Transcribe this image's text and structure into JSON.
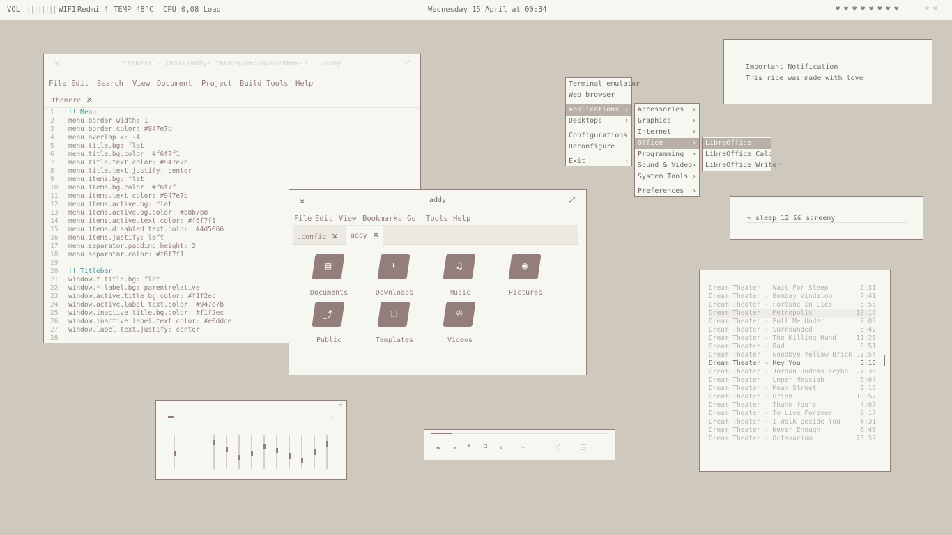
{
  "topbar": {
    "vol_label": "VOL",
    "vol_meter": "||||||||",
    "wifi_label": "WIFI",
    "wifi_value": "Redmi 4",
    "temp_label": "TEMP",
    "temp_value": "48°C",
    "cpu_label": "CPU",
    "cpu_value": "0,08 Load",
    "datetime": "Wednesday 15 April at 00:34",
    "hearts_filled": "♥ ♥ ♥ ♥ ♥ ♥ ♥ ♥",
    "hearts_empty": "♥ ♥"
  },
  "geany": {
    "title": "themerc - /home/addy/.themes/Umbra/openbox-3 - Geany",
    "close": "×",
    "maximize": "⤢",
    "menu": [
      "File",
      "Edit",
      "Search",
      "View",
      "Document",
      "Project",
      "Build",
      "Tools",
      "Help"
    ],
    "tab": "themerc",
    "tab_close": "✕",
    "lines": [
      {
        "n": "1",
        "t": "!! Menu"
      },
      {
        "n": "2",
        "t": "menu.border.width: 1"
      },
      {
        "n": "3",
        "t": "menu.border.color: #947e7b"
      },
      {
        "n": "4",
        "t": "menu.overlap.x: -4"
      },
      {
        "n": "5",
        "t": "menu.title.bg: flat"
      },
      {
        "n": "6",
        "t": "menu.title.bg.color: #f6f7f1"
      },
      {
        "n": "7",
        "t": "menu.title.text.color: #947e7b"
      },
      {
        "n": "8",
        "t": "menu.title.text.justify: center"
      },
      {
        "n": "9",
        "t": "menu.items.bg: flat"
      },
      {
        "n": "10",
        "t": "menu.items.bg.color: #f6f7f1"
      },
      {
        "n": "11",
        "t": "menu.items.text.color: #947e7b"
      },
      {
        "n": "12",
        "t": "menu.items.active.bg: flat"
      },
      {
        "n": "13",
        "t": "menu.items.active.bg.color: #b8b7b8"
      },
      {
        "n": "14",
        "t": "menu.items.active.text.color: #f6f7f1"
      },
      {
        "n": "15",
        "t": "menu.items.disabled.text.color: #4d5066"
      },
      {
        "n": "16",
        "t": "menu.items.justify: left"
      },
      {
        "n": "17",
        "t": "menu.separator.padding.height: 2"
      },
      {
        "n": "18",
        "t": "menu.separator.color: #f6f7f1"
      },
      {
        "n": "19",
        "t": ""
      },
      {
        "n": "20",
        "t": "!! Titlebar"
      },
      {
        "n": "21",
        "t": "window.*.title.bg: flat"
      },
      {
        "n": "22",
        "t": "window.*.label.bg: parentrelative"
      },
      {
        "n": "23",
        "t": "window.active.title.bg.color: #f1f2ec"
      },
      {
        "n": "24",
        "t": "window.active.label.text.color: #947e7b"
      },
      {
        "n": "25",
        "t": "window.inactive.title.bg.color: #f1f2ec"
      },
      {
        "n": "26",
        "t": "window.inactive.label.text.color: #e0ddde"
      },
      {
        "n": "27",
        "t": "window.label.text.justify: center"
      },
      {
        "n": "28",
        "t": ""
      }
    ]
  },
  "filemanager": {
    "title": "addy",
    "close": "×",
    "maximize": "⤢",
    "menu": [
      "File",
      "Edit",
      "View",
      "Bookmarks",
      "Go",
      "Tools",
      "Help"
    ],
    "tabs": [
      {
        "label": ".config",
        "close": "✕"
      },
      {
        "label": "addy",
        "close": "✕"
      }
    ],
    "folders": [
      {
        "name": "Documents",
        "icon": "document-folder-icon",
        "sym": "▤"
      },
      {
        "name": "Downloads",
        "icon": "download-folder-icon",
        "sym": "⬇"
      },
      {
        "name": "Music",
        "icon": "music-folder-icon",
        "sym": "♫"
      },
      {
        "name": "Pictures",
        "icon": "picture-folder-icon",
        "sym": "◉"
      },
      {
        "name": "Public",
        "icon": "share-folder-icon",
        "sym": "⤴"
      },
      {
        "name": "Templates",
        "icon": "template-folder-icon",
        "sym": "⬚"
      },
      {
        "name": "Videos",
        "icon": "video-folder-icon",
        "sym": "✇"
      }
    ]
  },
  "rootmenu": {
    "items": [
      "Terminal emulator",
      "Web browser",
      "Applications",
      "Desktops",
      "Configurations",
      "Reconfigure",
      "Exit"
    ],
    "arrow": "›"
  },
  "appsmenu": {
    "items": [
      "Accessories",
      "Graphics",
      "Internet",
      "Office",
      "Programming",
      "Sound & Video",
      "System Tools",
      "Preferences"
    ]
  },
  "officemenu": {
    "items": [
      "LibreOffice",
      "LibreOffice Calc",
      "LibreOffice Writer"
    ]
  },
  "notification": {
    "title": "Important Notification",
    "body": "This rice was made with love"
  },
  "terminal": {
    "command": "~ sleep 12 && screeny"
  },
  "playlist": {
    "tracks": [
      {
        "t": "Dream Theater - Wait For Sleep",
        "d": "2:31"
      },
      {
        "t": "Dream Theater - Bombay Vindaloo",
        "d": "7:41"
      },
      {
        "t": "Dream Theater - Fortune in Lies",
        "d": "5:56"
      },
      {
        "t": "Dream Theater - Metropolis",
        "d": "10:14"
      },
      {
        "t": "Dream Theater - Pull Me Under",
        "d": "9:03"
      },
      {
        "t": "Dream Theater - Surrounded",
        "d": "5:42"
      },
      {
        "t": "Dream Theater - The Killing Hand",
        "d": "11:28"
      },
      {
        "t": "Dream Theater - Bad",
        "d": "6:51"
      },
      {
        "t": "Dream Theater - Goodbye Yellow Brick ...",
        "d": "3:54"
      },
      {
        "t": "Dream Theater - Hey You",
        "d": "5:16"
      },
      {
        "t": "Dream Theater - Jordan Rudess Keybo...",
        "d": "7:36"
      },
      {
        "t": "Dream Theater - Leper Messiah",
        "d": "6:04"
      },
      {
        "t": "Dream Theater - Mean Street",
        "d": "2:13"
      },
      {
        "t": "Dream Theater - Orion",
        "d": "10:57"
      },
      {
        "t": "Dream Theater - Thank You's",
        "d": "4:07"
      },
      {
        "t": "Dream Theater - To Live Forever",
        "d": "8:17"
      },
      {
        "t": "Dream Theater - I Walk Beside You",
        "d": "4:31"
      },
      {
        "t": "Dream Theater - Never Enough",
        "d": "6:48"
      },
      {
        "t": "Dream Theater - Octavarium",
        "d": "23:59"
      }
    ],
    "current_index": 9
  },
  "equalizer": {
    "bands": [
      0.45,
      0.85,
      0.6,
      0.3,
      0.45,
      0.7,
      0.55,
      0.35,
      0.2,
      0.5,
      0.8
    ],
    "chevron": "⌄",
    "plus": "+"
  },
  "player": {
    "controls": [
      {
        "name": "previous-button",
        "sym": "«"
      },
      {
        "name": "play-button",
        "sym": "›"
      },
      {
        "name": "pause-button",
        "sym": "⏸"
      },
      {
        "name": "stop-button",
        "sym": "◻"
      },
      {
        "name": "next-button",
        "sym": "»"
      },
      {
        "name": "add-button",
        "sym": "+"
      },
      {
        "name": "shuffle-button",
        "sym": "⤮"
      },
      {
        "name": "playlist-button",
        "sym": "☰"
      }
    ],
    "progress": 0.12
  }
}
